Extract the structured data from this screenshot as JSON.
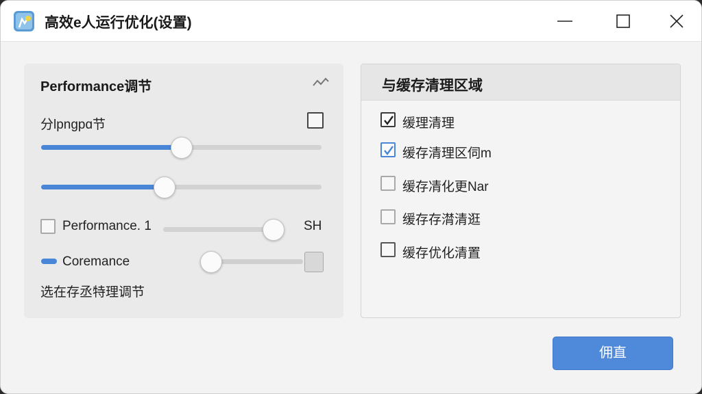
{
  "window": {
    "title": "高效e人运行优化(设置)",
    "icon": "app-icon",
    "controls": [
      "minimize-icon",
      "maximize-icon",
      "close-icon"
    ]
  },
  "left_panel": {
    "title": "Performance调节",
    "collapse_icon": "chevron-up-icon",
    "toggle_row_label": "分lpngpɑ节",
    "toggle_checked": false,
    "slider1": {
      "value": 0.5
    },
    "slider2": {
      "value": 0.44
    },
    "perf_row": {
      "label": "Performance. 1",
      "checked": false,
      "slider_value": 0.9,
      "suffix": "SH"
    },
    "core_row": {
      "label": "Coremance",
      "slider_value": 0.0
    },
    "footer_text": "选在存丞特理调节"
  },
  "right_panel": {
    "title": "与缓存清理区域",
    "items": [
      {
        "label": "缓理清理",
        "checked": true,
        "style": "dark"
      },
      {
        "label": "缓存清理区伺m",
        "checked": true,
        "style": "blue"
      },
      {
        "label": "缓存凊化更Nar",
        "checked": false,
        "style": "light"
      },
      {
        "label": "缓存存潸清逛",
        "checked": false,
        "style": "light"
      },
      {
        "label": "缓存优化清置",
        "checked": false,
        "style": "dark"
      }
    ]
  },
  "primary_button": {
    "label": "佣直"
  },
  "colors": {
    "accent": "#4a86d8",
    "background": "#f3f3f3"
  }
}
